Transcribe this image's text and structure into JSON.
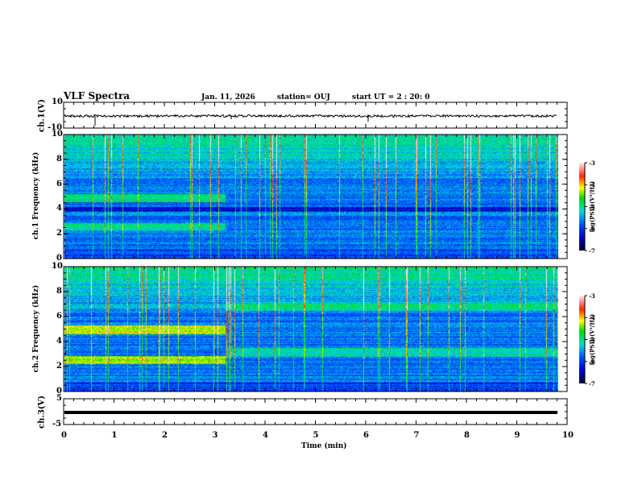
{
  "header": {
    "title": "VLF Spectra",
    "date": "Jan. 11, 2026",
    "station": "station= OUJ",
    "start_ut": "start  UT =  2 : 20: 0"
  },
  "chart_data": [
    {
      "type": "line",
      "name_label": "ch.1(V)",
      "ylim": [
        -10,
        10
      ],
      "y_ticks": [
        "10",
        "-10"
      ],
      "xlim": [
        0,
        10
      ]
    },
    {
      "type": "heatmap",
      "ylabel": "ch.1 Frequency (kHz)",
      "ylim": [
        0,
        10
      ],
      "y_ticks": [
        "0",
        "2",
        "4",
        "6",
        "8",
        "10"
      ],
      "xlim": [
        0,
        10
      ],
      "colorbar": {
        "label": "log(PSD)(V²/Hz)",
        "range": [
          -7,
          -3
        ],
        "ticks": [
          "-3",
          "-4",
          "-5",
          "-6",
          "-7"
        ]
      }
    },
    {
      "type": "heatmap",
      "ylabel": "ch.2 Frequency (kHz)",
      "ylim": [
        0,
        10
      ],
      "y_ticks": [
        "0",
        "2",
        "4",
        "6",
        "8",
        "10"
      ],
      "xlim": [
        0,
        10
      ],
      "colorbar": {
        "label": "log(PSD)(V²/Hz)",
        "range": [
          -7,
          -3
        ],
        "ticks": [
          "-3",
          "-4",
          "-5",
          "-6",
          "-7"
        ]
      }
    },
    {
      "type": "line",
      "name_label": "ch.3(V)",
      "ylim": [
        -5,
        5
      ],
      "y_ticks": [
        "5",
        "-5"
      ],
      "xlim": [
        0,
        10
      ]
    }
  ],
  "xaxis": {
    "label": "Time (min)",
    "ticks": [
      "0",
      "1",
      "2",
      "3",
      "4",
      "5",
      "6",
      "7",
      "8",
      "9",
      "10"
    ]
  },
  "colors": {
    "line": "#000000"
  }
}
